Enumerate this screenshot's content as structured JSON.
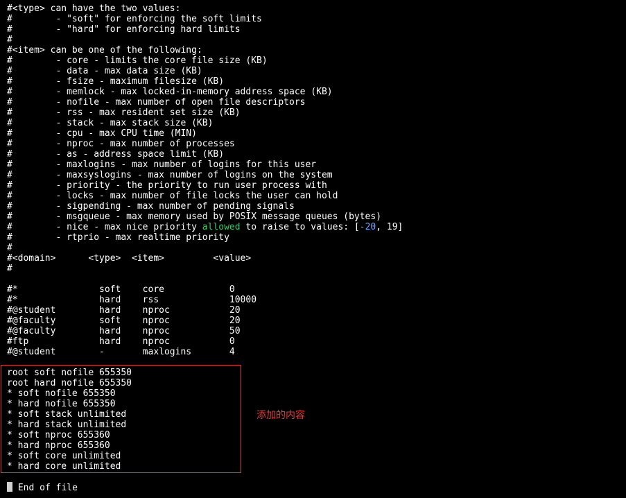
{
  "terminal": {
    "lines_top": [
      "#<type> can have the two values:",
      "#        - \"soft\" for enforcing the soft limits",
      "#        - \"hard\" for enforcing hard limits",
      "#",
      "#<item> can be one of the following:",
      "#        - core - limits the core file size (KB)",
      "#        - data - max data size (KB)",
      "#        - fsize - maximum filesize (KB)",
      "#        - memlock - max locked-in-memory address space (KB)",
      "#        - nofile - max number of open file descriptors",
      "#        - rss - max resident set size (KB)",
      "#        - stack - max stack size (KB)",
      "#        - cpu - max CPU time (MIN)",
      "#        - nproc - max number of processes",
      "#        - as - address space limit (KB)",
      "#        - maxlogins - max number of logins for this user",
      "#        - maxsyslogins - max number of logins on the system",
      "#        - priority - the priority to run user process with",
      "#        - locks - max number of file locks the user can hold",
      "#        - sigpending - max number of pending signals",
      "#        - msgqueue - max memory used by POSIX message queues (bytes)"
    ],
    "nice_line": {
      "prefix": "#        - nice - max nice priority ",
      "keyword": "allowed",
      "middle": " to raise to values: [",
      "neg_num": "-20",
      "suffix": ", 19]"
    },
    "lines_mid": [
      "#        - rtprio - max realtime priority",
      "#",
      "#<domain>      <type>  <item>         <value>",
      "#",
      "",
      "#*               soft    core            0",
      "#*               hard    rss             10000",
      "#@student        hard    nproc           20",
      "#@faculty        soft    nproc           20",
      "#@faculty        hard    nproc           50",
      "#ftp             hard    nproc           0",
      "#@student        -       maxlogins       4",
      ""
    ],
    "added_lines": [
      "root soft nofile 655350",
      "root hard nofile 655350",
      "* soft nofile 655350",
      "* hard nofile 655350",
      "* soft stack unlimited",
      "* hard stack unlimited",
      "* soft nproc 655360",
      "* hard nproc 655360",
      "* soft core unlimited",
      "* hard core unlimited"
    ],
    "blank_after": "",
    "end_line_text": " End of file"
  },
  "annotation": {
    "text": "添加的内容"
  },
  "colors": {
    "background": "#000000",
    "text": "#ffffff",
    "keyword": "#33cc66",
    "number": "#6fa8ff",
    "box": "#e23a3a"
  }
}
